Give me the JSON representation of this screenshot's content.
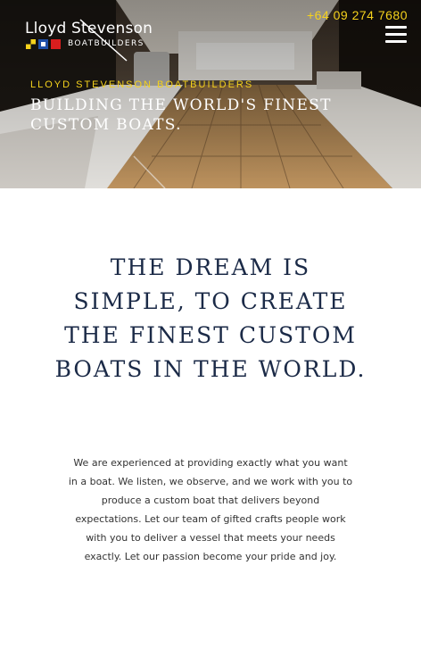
{
  "brand": {
    "name": "Lloyd Stevenson",
    "sub": "BOATBUILDERS"
  },
  "header": {
    "phone": "+64 09 274 7680"
  },
  "hero": {
    "kicker": "LLOYD STEVENSON BOATBUILDERS",
    "title": "BUILDING THE WORLD'S FINEST CUSTOM BOATS."
  },
  "content": {
    "heading": "THE DREAM IS SIMPLE, TO CREATE THE FINEST CUSTOM BOATS IN THE WORLD.",
    "intro": "We are experienced at providing exactly what you want in a boat. We listen, we observe, and we work with you to produce a custom boat that delivers beyond expectations. Let our team of gifted crafts people work with you to deliver a vessel that meets your needs exactly. Let our passion become your pride and joy."
  },
  "colors": {
    "accent": "#f5d21c",
    "heading": "#1b2a47",
    "text": "#333333"
  },
  "icons": {
    "menu": "hamburger-menu-icon",
    "flags": "signal-flags-icon"
  }
}
